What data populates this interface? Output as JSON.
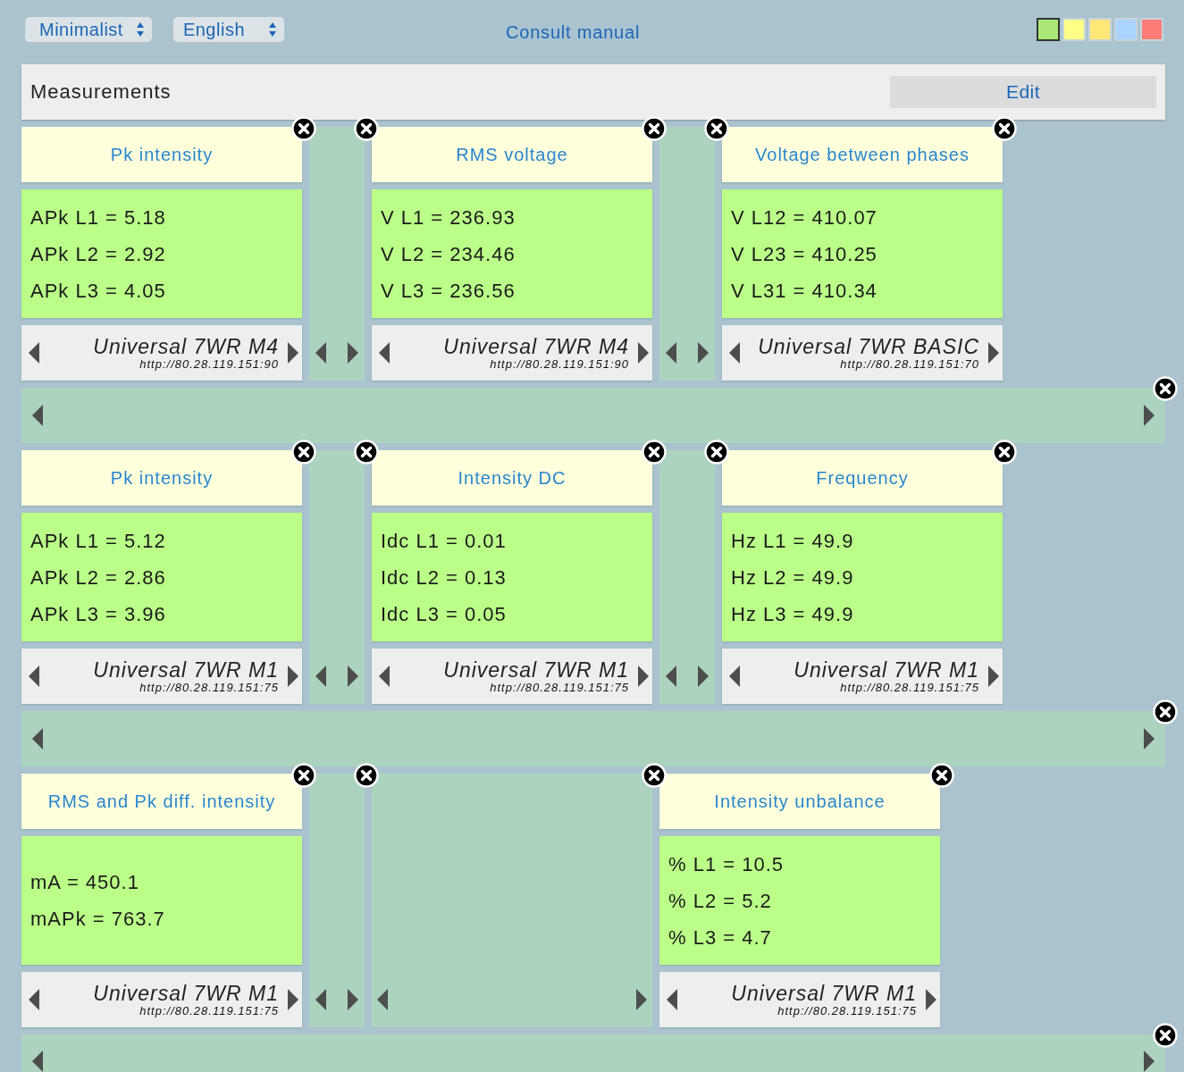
{
  "top_bar": {
    "style_select": "Minimalist",
    "language_select": "English",
    "manual_link": "Consult manual",
    "themes": [
      {
        "color": "#aae777",
        "selected": true
      },
      {
        "color": "#ffff88",
        "selected": false
      },
      {
        "color": "#ffe877",
        "selected": false
      },
      {
        "color": "#aad4ff",
        "selected": false
      },
      {
        "color": "#ff7c77",
        "selected": false
      }
    ]
  },
  "panel": {
    "title": "Measurements",
    "edit_button": "Edit"
  },
  "rows": [
    {
      "items": [
        {
          "kind": "card",
          "title": "Pk intensity",
          "lines": [
            "APk L1 = 5.18",
            "APk L2 = 2.92",
            "APk L3 = 4.05"
          ],
          "device": "Universal 7WR M4",
          "url": "http://80.28.119.151:90"
        },
        {
          "kind": "spacer"
        },
        {
          "kind": "card",
          "title": "RMS voltage",
          "lines": [
            "V L1 = 236.93",
            "V L2 = 234.46",
            "V L3 = 236.56"
          ],
          "device": "Universal 7WR M4",
          "url": "http://80.28.119.151:90"
        },
        {
          "kind": "spacer"
        },
        {
          "kind": "card",
          "title": "Voltage between phases",
          "lines": [
            "V L12 = 410.07",
            "V L23 = 410.25",
            "V L31 = 410.34"
          ],
          "device": "Universal 7WR BASIC",
          "url": "http://80.28.119.151:70"
        }
      ]
    },
    {
      "items": [
        {
          "kind": "card",
          "title": "Pk intensity",
          "lines": [
            "APk L1 = 5.12",
            "APk L2 = 2.86",
            "APk L3 = 3.96"
          ],
          "device": "Universal 7WR M1",
          "url": "http://80.28.119.151:75"
        },
        {
          "kind": "spacer"
        },
        {
          "kind": "card",
          "title": "Intensity DC",
          "lines": [
            "Idc L1 = 0.01",
            "Idc L2 = 0.13",
            "Idc L3 = 0.05"
          ],
          "device": "Universal 7WR M1",
          "url": "http://80.28.119.151:75"
        },
        {
          "kind": "spacer"
        },
        {
          "kind": "card",
          "title": "Frequency",
          "lines": [
            "Hz L1 = 49.9",
            "Hz L2 = 49.9",
            "Hz L3 = 49.9"
          ],
          "device": "Universal 7WR M1",
          "url": "http://80.28.119.151:75"
        }
      ]
    },
    {
      "items": [
        {
          "kind": "card",
          "title": "RMS and Pk diff. intensity",
          "lines": [
            "mA = 450.1",
            "mAPk = 763.7"
          ],
          "device": "Universal 7WR M1",
          "url": "http://80.28.119.151:75"
        },
        {
          "kind": "spacer"
        },
        {
          "kind": "empty"
        },
        {
          "kind": "card",
          "title": "Intensity unbalance",
          "lines": [
            "% L1 = 10.5",
            "% L2 = 5.2",
            "% L3 = 4.7"
          ],
          "device": "Universal 7WR M1",
          "url": "http://80.28.119.151:75"
        }
      ]
    }
  ]
}
